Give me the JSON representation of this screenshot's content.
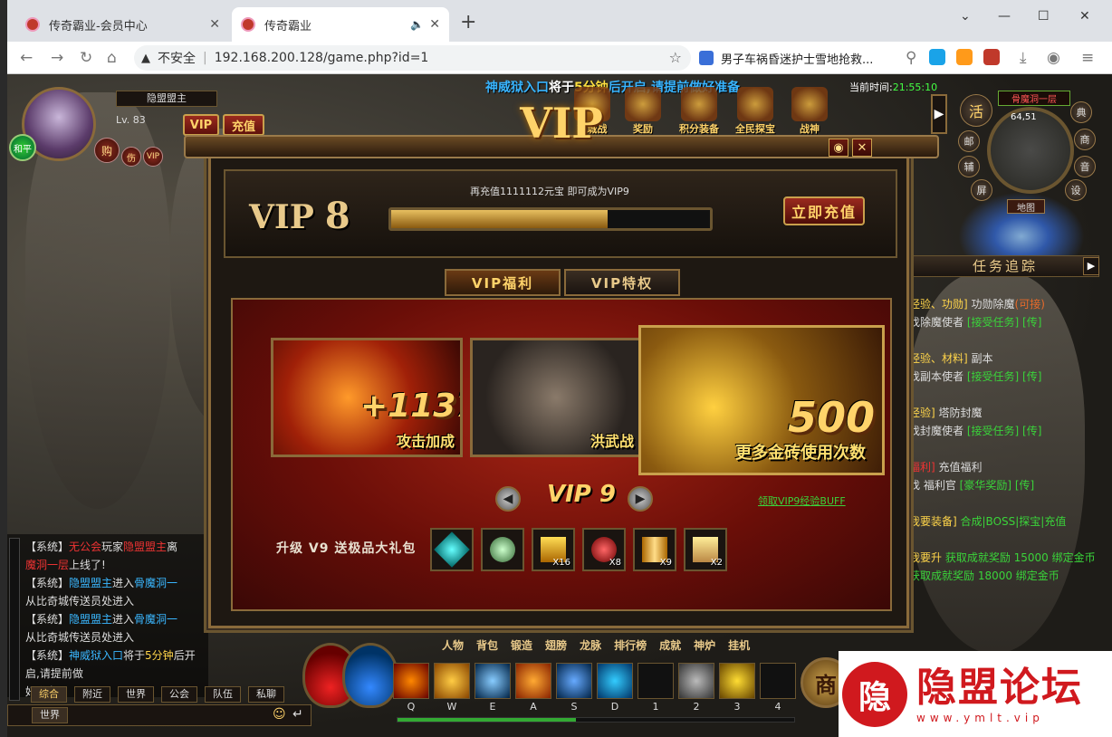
{
  "browser": {
    "tabs": [
      {
        "title": "传奇霸业-会员中心",
        "active": false
      },
      {
        "title": "传奇霸业",
        "active": true
      }
    ],
    "address": {
      "security": "不安全",
      "url": "192.168.200.128/game.php?id=1"
    },
    "news_title": "男子车祸昏迷护士雪地抢救..."
  },
  "game": {
    "announcement": {
      "prefix": "神威狱入口",
      "mid": "将于",
      "highlight": "5分钟",
      "suffix": "后开启,请提前做好准备"
    },
    "clock": {
      "label": "当前时间:",
      "time": "21:55:10"
    },
    "player": {
      "name": "隐盟盟主",
      "level": "Lv. 83",
      "mode": "和平",
      "vip_button": "VIP",
      "recharge_button": "充值",
      "buy_button": "购",
      "status_icons": [
        "伤",
        "VIP"
      ]
    },
    "top_icons": [
      "攻城战",
      "奖励",
      "积分装备",
      "全民探宝",
      "战神"
    ],
    "minimap": {
      "title": "骨魔洞一层",
      "coords": "64,51",
      "buttons": [
        "活",
        "典",
        "邮",
        "辅",
        "商",
        "音",
        "屏",
        "设"
      ],
      "map_label": "地图"
    },
    "quest_panel": {
      "title": "任务追踪",
      "lines": [
        [
          {
            "t": "经验、功勋]",
            "c": "y"
          },
          {
            "t": " 功勋除魔",
            "c": "w"
          },
          {
            "t": "(可接)",
            "c": "o"
          }
        ],
        [
          {
            "t": "找除魔使者 ",
            "c": "w"
          },
          {
            "t": "[接受任务]",
            "c": "g"
          },
          {
            "t": " [传]",
            "c": "g"
          }
        ],
        [
          {
            "t": "",
            "c": "w"
          }
        ],
        [
          {
            "t": "经验、材料]",
            "c": "y"
          },
          {
            "t": " 副本",
            "c": "w"
          }
        ],
        [
          {
            "t": "找副本使者 ",
            "c": "w"
          },
          {
            "t": "[接受任务]",
            "c": "g"
          },
          {
            "t": " [传]",
            "c": "g"
          }
        ],
        [
          {
            "t": "",
            "c": "w"
          }
        ],
        [
          {
            "t": "经验]",
            "c": "y"
          },
          {
            "t": " 塔防封魔",
            "c": "w"
          }
        ],
        [
          {
            "t": "找封魔使者 ",
            "c": "w"
          },
          {
            "t": "[接受任务]",
            "c": "g"
          },
          {
            "t": " [传]",
            "c": "g"
          }
        ],
        [
          {
            "t": "",
            "c": "w"
          }
        ],
        [
          {
            "t": "福利]",
            "c": "r"
          },
          {
            "t": " 充值福利",
            "c": "w"
          }
        ],
        [
          {
            "t": "找 福利官 ",
            "c": "w"
          },
          {
            "t": "[豪华奖励]",
            "c": "g"
          },
          {
            "t": " [传]",
            "c": "g"
          }
        ],
        [
          {
            "t": "",
            "c": "w"
          }
        ],
        [
          {
            "t": "我要装备]",
            "c": "y"
          },
          {
            "t": " 合成|BOSS|探宝|充值",
            "c": "g"
          }
        ],
        [
          {
            "t": "",
            "c": "w"
          }
        ],
        [
          {
            "t": "我要升",
            "c": "y"
          },
          {
            "t": " 获取成就奖励 15000 绑定金币",
            "c": "g"
          }
        ],
        [
          {
            "t": "            获取成就奖励 18000 绑定金币",
            "c": "g"
          }
        ]
      ]
    },
    "chat": {
      "lines": [
        [
          {
            "t": "【系统】",
            "c": "w"
          },
          {
            "t": "无公会",
            "c": "r"
          },
          {
            "t": "玩家",
            "c": "w"
          },
          {
            "t": "隐盟盟主",
            "c": "r"
          },
          {
            "t": "离",
            "c": "w"
          }
        ],
        [
          {
            "t": "魔洞一层",
            "c": "r"
          },
          {
            "t": "上线了!",
            "c": "w"
          }
        ],
        [
          {
            "t": "【系统】",
            "c": "w"
          },
          {
            "t": "隐盟盟主",
            "c": "c"
          },
          {
            "t": "进入",
            "c": "w"
          },
          {
            "t": "骨魔洞一",
            "c": "c"
          }
        ],
        [
          {
            "t": "从比奇城传送员处进入",
            "c": "w"
          }
        ],
        [
          {
            "t": "【系统】",
            "c": "w"
          },
          {
            "t": "隐盟盟主",
            "c": "c"
          },
          {
            "t": "进入",
            "c": "w"
          },
          {
            "t": "骨魔洞一",
            "c": "c"
          }
        ],
        [
          {
            "t": "从比奇城传送员处进入",
            "c": "w"
          }
        ],
        [
          {
            "t": "【系统】",
            "c": "w"
          },
          {
            "t": "神威狱入口",
            "c": "c"
          },
          {
            "t": "将于",
            "c": "w"
          },
          {
            "t": "5分钟",
            "c": "y"
          },
          {
            "t": "后开启,请提前做",
            "c": "w"
          }
        ],
        [
          {
            "t": "好准备",
            "c": "w"
          }
        ]
      ],
      "tabs": [
        "综合",
        "附近",
        "世界",
        "公会",
        "队伍",
        "私聊"
      ],
      "input_channel": "世界"
    },
    "menu": [
      "人物",
      "背包",
      "锻造",
      "翅膀",
      "龙脉",
      "排行榜",
      "成就",
      "神炉",
      "挂机"
    ],
    "skill_keys": [
      "Q",
      "W",
      "E",
      "A",
      "S",
      "D",
      "1",
      "2",
      "3",
      "4"
    ],
    "shop_button": "商",
    "watermark": {
      "logo": "隐",
      "title": "隐盟论坛",
      "url": "www.ymlt.vip"
    }
  },
  "vip_dialog": {
    "title": "VIP",
    "current_label": "VIP",
    "current_level": "8",
    "recharge_tip": "再充值1111112元宝 即可成为VIP9",
    "progress": 0.68,
    "recharge_button": "立即充值",
    "tabs": [
      "VIP福利",
      "VIP特权"
    ],
    "cards": [
      {
        "big": "+1137",
        "caption": "攻击加成"
      },
      {
        "big": "",
        "caption": "洪武战"
      },
      {
        "big": "500",
        "caption": "更多金砖使用次数"
      }
    ],
    "next_level": "VIP 9",
    "buff_link": "领取VIP9经验BUFF",
    "gift_label": "升级 V9 送极品大礼包",
    "gifts": [
      {
        "icon": "crystal-icon",
        "count": ""
      },
      {
        "icon": "lotus-icon",
        "count": ""
      },
      {
        "icon": "gold-bar-icon",
        "count": "X16"
      },
      {
        "icon": "gem-icon",
        "count": "X8"
      },
      {
        "icon": "scroll-icon",
        "count": "X9"
      },
      {
        "icon": "parchment-icon",
        "count": "X2"
      }
    ],
    "colors": {
      "gold": "#ffd36a",
      "frame": "#8a6a3a",
      "red": "#a52414"
    }
  }
}
